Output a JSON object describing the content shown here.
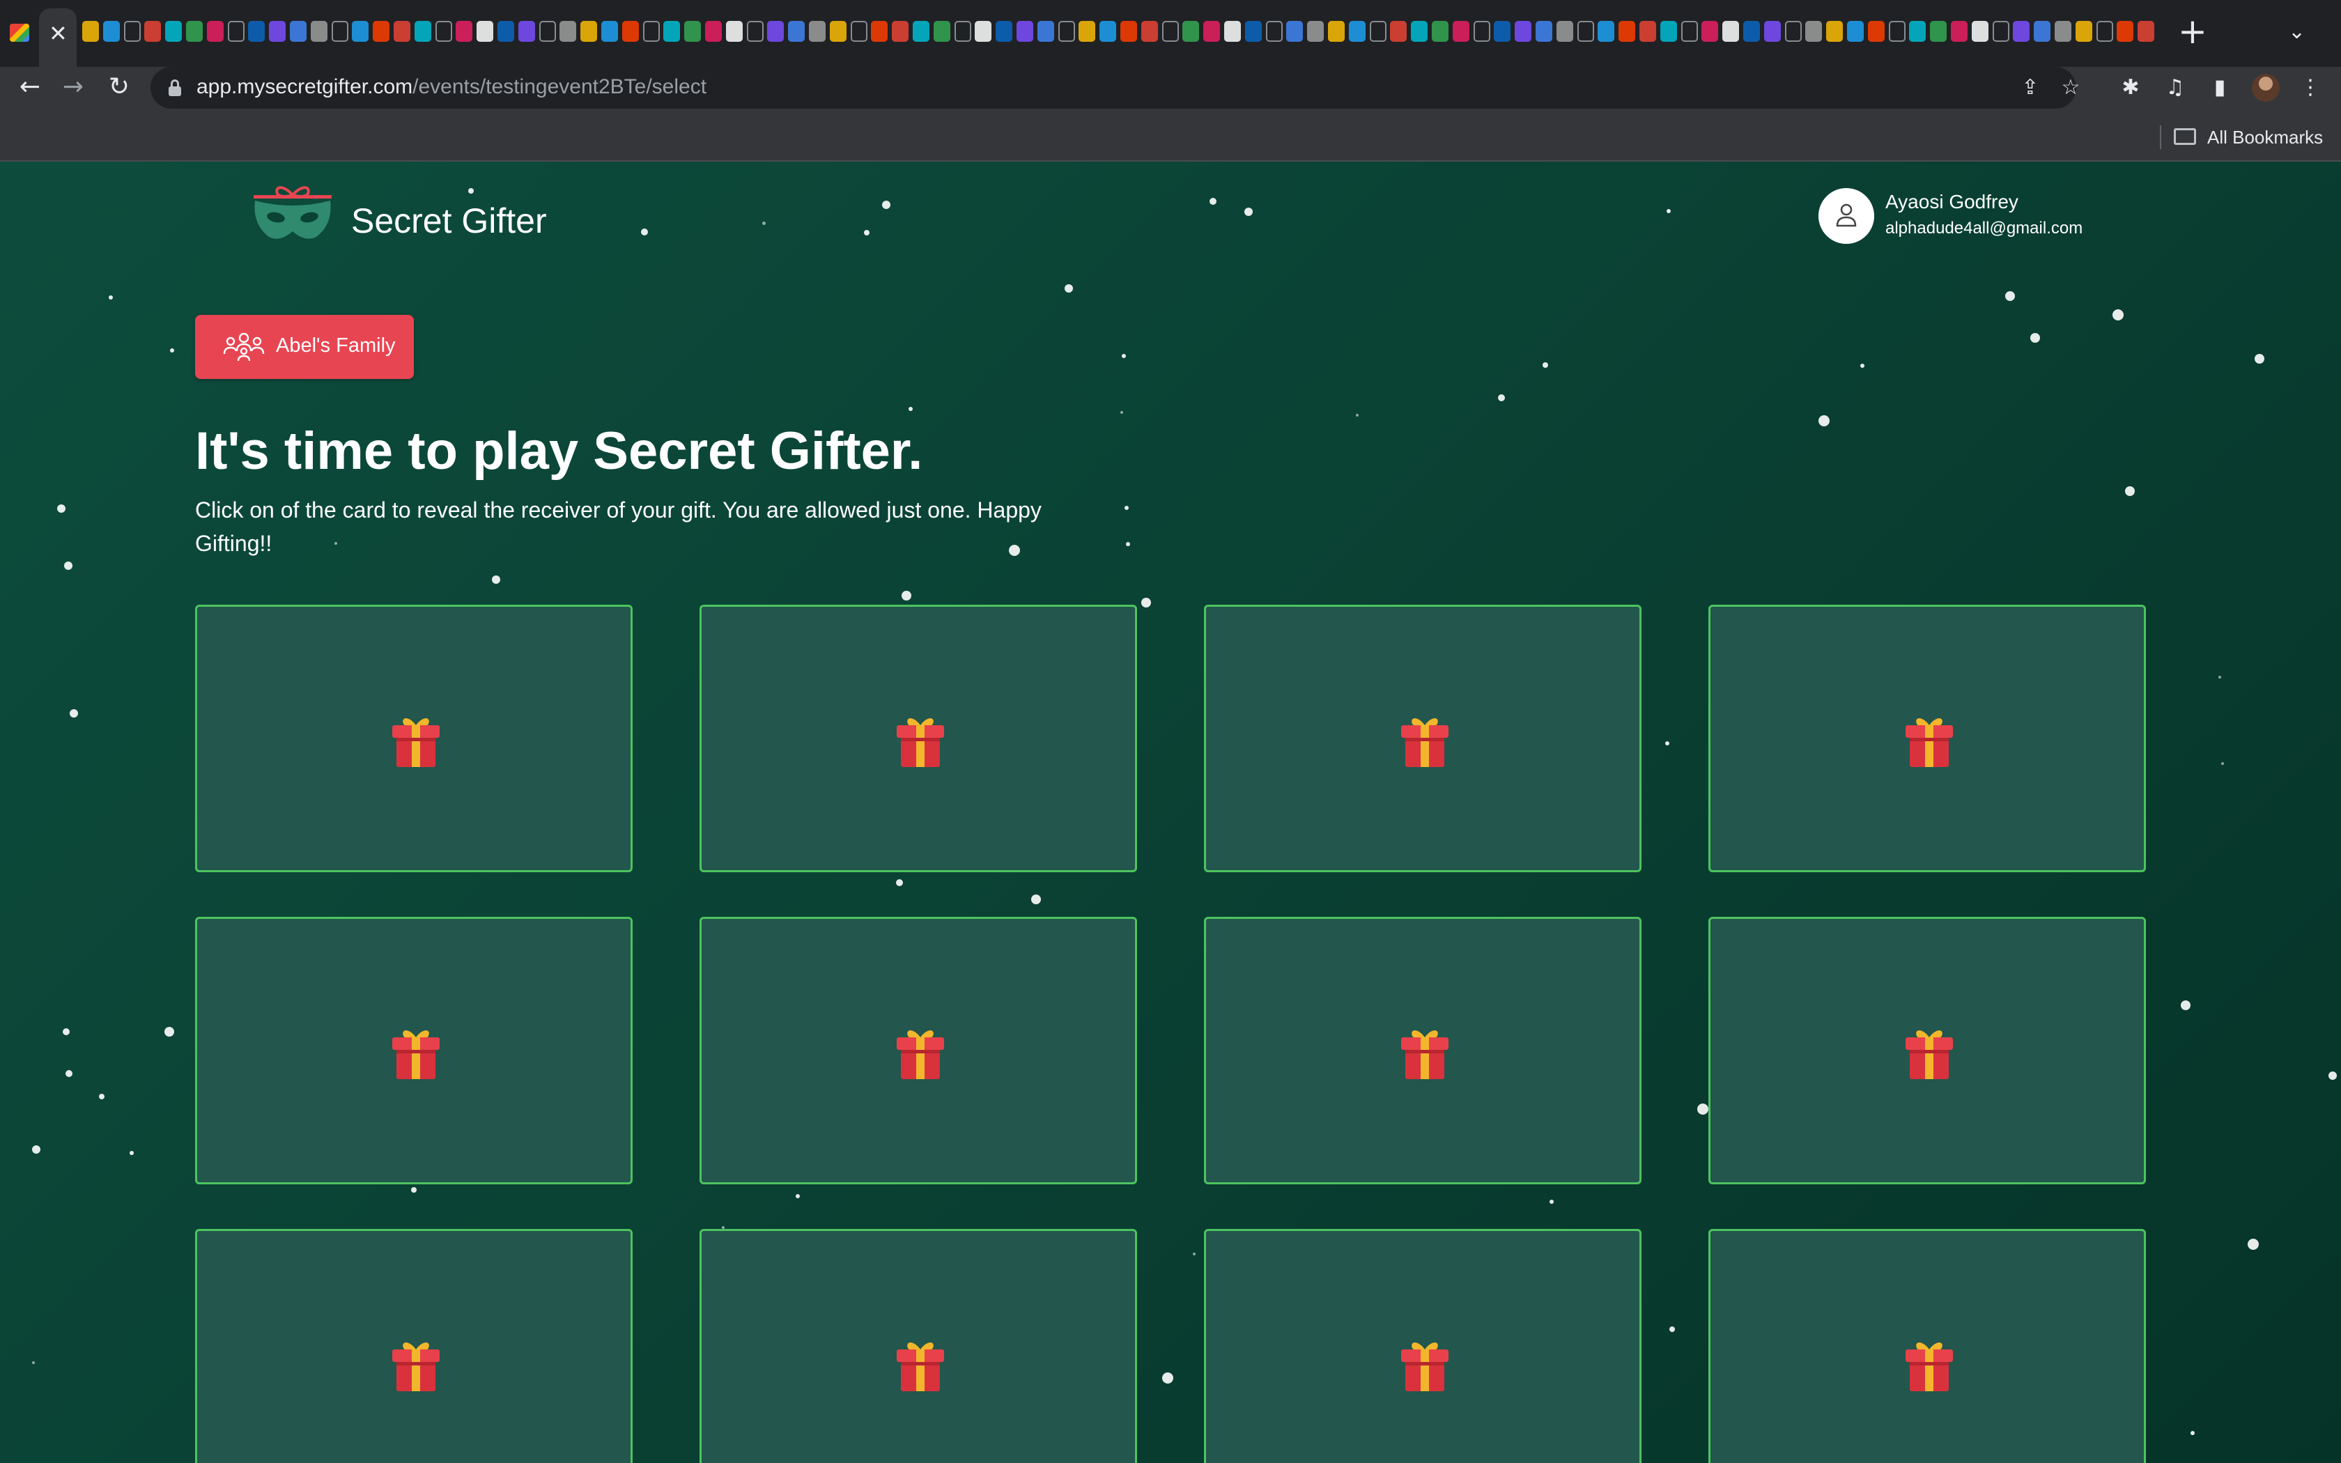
{
  "browser": {
    "tab_close_glyph": "✕",
    "new_tab_glyph": "+",
    "tab_menu_glyph": "⌄",
    "url_host": "app.mysecretgifter.com",
    "url_path": "/events/testingevent2BTe/select",
    "bookmarks_label": "All Bookmarks",
    "icons": {
      "back": "←",
      "forward": "→",
      "reload": "↻",
      "share": "⇪",
      "star": "☆",
      "extensions": "✱",
      "media": "♫",
      "sidebar": "▮",
      "menu": "⋮"
    }
  },
  "app": {
    "logo_text": "Secret Gifter",
    "user": {
      "name": "Ayaosi Godfrey",
      "email": "alphadude4all@gmail.com"
    },
    "group_button_label": "Abel's Family",
    "headline": "It's time to play Secret Gifter.",
    "instructions": "Click on of the card to reveal the receiver of your gift. You are allowed just one. Happy Gifting!!",
    "cards": [
      {
        "id": 1
      },
      {
        "id": 2
      },
      {
        "id": 3
      },
      {
        "id": 4
      },
      {
        "id": 5
      },
      {
        "id": 6
      },
      {
        "id": 7
      },
      {
        "id": 8
      },
      {
        "id": 9
      },
      {
        "id": 10
      },
      {
        "id": 11
      },
      {
        "id": 12
      }
    ]
  },
  "colors": {
    "accent_red": "#e84552",
    "card_border": "#4cc45e",
    "card_fill": "#23564d",
    "background": "#0a4234"
  }
}
